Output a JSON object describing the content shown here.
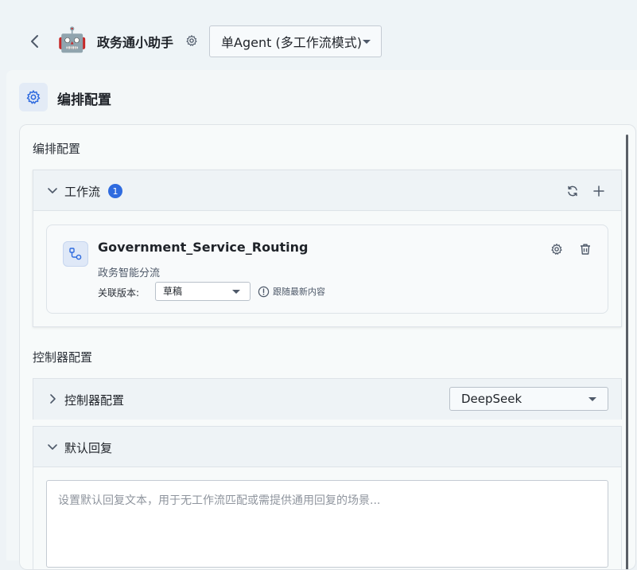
{
  "header": {
    "app_title": "政务通小助手",
    "mode_value": "单Agent (多工作流模式)"
  },
  "section": {
    "title": "编排配置"
  },
  "orchestration": {
    "group_label": "编排配置",
    "workflow_panel": {
      "title": "工作流",
      "count": "1",
      "items": [
        {
          "name": "Government_Service_Routing",
          "description": "政务智能分流",
          "version_label": "关联版本:",
          "version_value": "草稿",
          "follow_hint": "跟随最新内容"
        }
      ]
    }
  },
  "controller": {
    "group_label": "控制器配置",
    "panel_title": "控制器配置",
    "model_value": "DeepSeek"
  },
  "default_reply": {
    "title": "默认回复",
    "placeholder": "设置默认回复文本，用于无工作流匹配或需提供通用回复的场景..."
  },
  "colors": {
    "accent": "#2f6bdf",
    "background": "#eef3f6"
  },
  "icons": {
    "back": "chevron-left-icon",
    "robot": "robot-icon",
    "settings": "gear-icon",
    "refresh": "refresh-icon",
    "add": "plus-icon",
    "workflow": "workflow-icon",
    "delete": "trash-icon",
    "info": "info-circle-icon"
  }
}
